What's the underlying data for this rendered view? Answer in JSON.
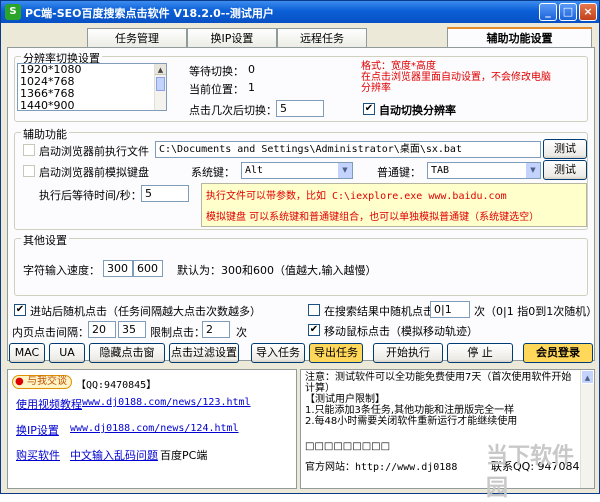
{
  "window": {
    "title": "PC端-SEO百度搜索点击软件 V18.2.0--测试用户"
  },
  "tabs": [
    "任务管理",
    "换IP设置",
    "远程任务",
    "辅助功能设置"
  ],
  "resolution": {
    "group_title": "分辨率切换设置",
    "items": [
      "1920*1080",
      "1024*768",
      "1366*768",
      "1440*900"
    ],
    "wait_label": "等待切换：",
    "wait_value": "0",
    "position_label": "当前位置：",
    "position_value": "1",
    "click_label": "点击几次后切换：",
    "click_value": "5",
    "note": "格式：宽度*高度\n在点击浏览器里面自动设置，不会修改电脑分辨率",
    "auto_switch_label": "自动切换分辨率",
    "auto_switch_checked": "✔"
  },
  "assist": {
    "group_title": "辅助功能",
    "exec_label": "启动浏览器前执行文件",
    "exec_path": "C:\\Documents and Settings\\Administrator\\桌面\\sx.bat",
    "test1": "测试",
    "keys_label": "启动浏览器前模拟键盘",
    "syskey_label": "系统键：",
    "syskey_value": "Alt",
    "normalkey_label": "普通键：",
    "normalkey_value": "TAB",
    "test2": "测试",
    "wait_label": "执行后等待时间/秒：",
    "wait_value": "5",
    "note1": "执行文件可以带参数，比如 C:\\iexplore.exe www.baidu.com",
    "note2": "模拟键盘 可以系统键和普通键组合，也可以单独模拟普通键（系统键选空）"
  },
  "other": {
    "group_title": "其他设置",
    "speed_label": "字符输入速度：",
    "speed_min": "300",
    "speed_max": "600",
    "speed_default": "默认为：300和600（值越大,输入越慢）"
  },
  "options": {
    "random_click_label": "进站后随机点击（任务间隔越大点击次数越多）",
    "random_click_checked": "✔",
    "interval_label": "内页点击间隔：",
    "interval_min": "20",
    "interval_max": "35",
    "limit_label": "限制点击：",
    "limit_value": "2",
    "limit_unit": "次",
    "search_random_label": "在搜索结果中随机点击",
    "search_random_value": "0|1",
    "search_random_note": "次（0|1 指0到1次随机）",
    "move_mouse_label": "移动鼠标点击（模拟移动轨迹）",
    "move_mouse_checked": "✔"
  },
  "toolbar": {
    "mac": "MAC",
    "ua": "UA",
    "hide_window": "隐藏点击窗",
    "click_filter": "点击过滤设置",
    "import_task": "导入任务",
    "export_task": "导出任务",
    "start": "开始执行",
    "stop": "停 止",
    "login": "会员登录"
  },
  "left_panel": {
    "qq_badge": "与我交谈",
    "qq_text": "【QQ:9470845】",
    "link1": "使用视频教程",
    "url1": "www.dj0188.com/news/123.html",
    "link2": "换IP设置",
    "url2": "www.dj0188.com/news/124.html",
    "link3": "购买软件",
    "link4": "中文输入乱码问题",
    "text5": "百度PC端"
  },
  "right_panel": {
    "lines": [
      "注意：测试软件可以全功能免费使用7天（首次使用软件开始计算）",
      "【测试用户限制】",
      "1.只能添加3条任务,其他功能和注册版完全一样",
      "2.每48小时需要关闭软件重新运行才能继续使用",
      "□□□□□□□□□"
    ],
    "site_label": "官方网站：http://www.dj0188",
    "qq_label": "联系QQ: 9470845"
  },
  "watermark": "当下软件园",
  "colors": {
    "title_bar": "#0b5fd6",
    "red_text": "#e00000",
    "yellow": "#ffffcc",
    "login_btn": "#ffd75a"
  }
}
